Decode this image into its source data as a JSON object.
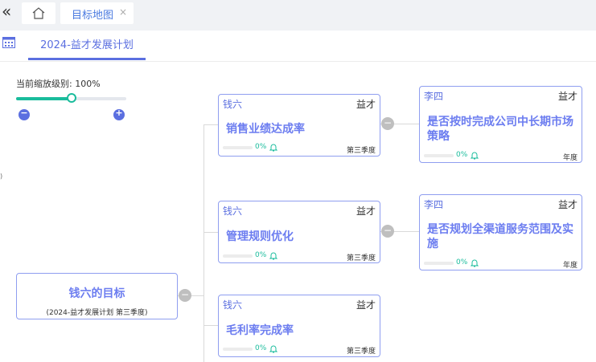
{
  "topbar": {
    "collapse_icon": "double-chevron-left-icon",
    "home_icon": "home-icon",
    "tab_label": "目标地图",
    "tab_close": "×"
  },
  "plan": {
    "calendar_icon": "calendar-grid-icon",
    "tab_label": "2024-益才发展计划"
  },
  "zoom": {
    "label": "当前缩放级别: 100%",
    "level_percent": 100,
    "slider_fraction": 0.5,
    "zoom_out_icon": "zoom-out-icon",
    "zoom_in_icon": "zoom-in-icon",
    "zoom_out_symbol": "−",
    "zoom_in_symbol": "+"
  },
  "root": {
    "title": "钱六的目标",
    "subtitle": "(2024-益才发展计划 第三季度)",
    "toggle": "−"
  },
  "nodes": [
    {
      "owner": "钱六",
      "org": "益才",
      "title": "销售业绩达成率",
      "progress": "0%",
      "progress_value": 0,
      "period": "第三季度",
      "toggle": "−"
    },
    {
      "owner": "钱六",
      "org": "益才",
      "title": "管理规则优化",
      "progress": "0%",
      "progress_value": 0,
      "period": "第三季度",
      "toggle": "−"
    },
    {
      "owner": "钱六",
      "org": "益才",
      "title": "毛利率完成率",
      "progress": "0%",
      "progress_value": 0,
      "period": "第三季度"
    },
    {
      "owner": "李四",
      "org": "益才",
      "title_line1": "是否按时完成公司中长期市场",
      "title_line2": "策略",
      "progress": "0%",
      "progress_value": 0,
      "period": "年度"
    },
    {
      "owner": "李四",
      "org": "益才",
      "title_line1": "是否规划全渠道服务范围及实",
      "title_line2": "施",
      "progress": "0%",
      "progress_value": 0,
      "period": "年度"
    }
  ],
  "edge_mark": ")",
  "colors": {
    "accent": "#5b6fe0",
    "node_title": "#6c7df0",
    "node_border": "#8f9ef0",
    "progress": "#1abc9c",
    "toggle": "#bfbfbf"
  }
}
